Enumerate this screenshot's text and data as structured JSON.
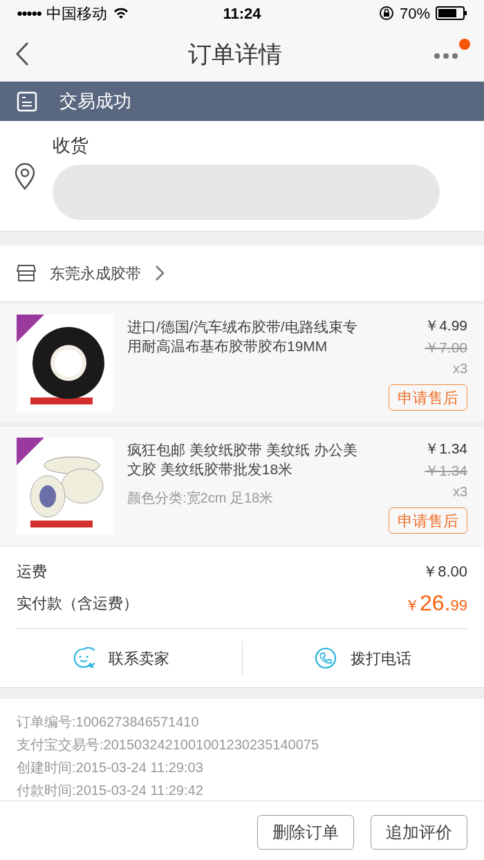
{
  "status_bar": {
    "signal_dots": "●●●●●",
    "carrier": "中国移动",
    "time": "11:24",
    "battery": "70%"
  },
  "nav": {
    "title": "订单详情",
    "has_notification": true
  },
  "status_banner": {
    "text": "交易成功"
  },
  "address": {
    "label": "收货"
  },
  "shop": {
    "name": "东莞永成胶带"
  },
  "items": [
    {
      "title": "进口/德国/汽车绒布胶带/电路线束专用耐高温布基布胶带胶布19MM",
      "price": "￥4.99",
      "original_price": "￥7.00",
      "quantity": "x3",
      "action": "申请售后"
    },
    {
      "title": "疯狂包邮 美纹纸胶带 美纹纸 办公美文胶 美纹纸胶带批发18米",
      "variant": "颜色分类:宽2cm 足18米",
      "price": "￥1.34",
      "original_price": "￥1.34",
      "quantity": "x3",
      "action": "申请售后"
    }
  ],
  "fees": [
    {
      "label": "运费",
      "value": "￥8.00",
      "kind": "plain"
    },
    {
      "label": "实付款（含运费）",
      "currency": "￥",
      "value": "26.",
      "cents": "99",
      "kind": "total"
    }
  ],
  "contact": [
    {
      "label": "联系卖家",
      "kind": "chat"
    },
    {
      "label": "拨打电话",
      "kind": "phone"
    }
  ],
  "order_info": [
    "订单编号:1006273846571410",
    "支付宝交易号:2015032421001001230235140075",
    "创建时间:2015-03-24 11:29:03",
    "付款时间:2015-03-24 11:29:42"
  ],
  "footer_buttons": [
    "删除订单",
    "追加评价"
  ]
}
